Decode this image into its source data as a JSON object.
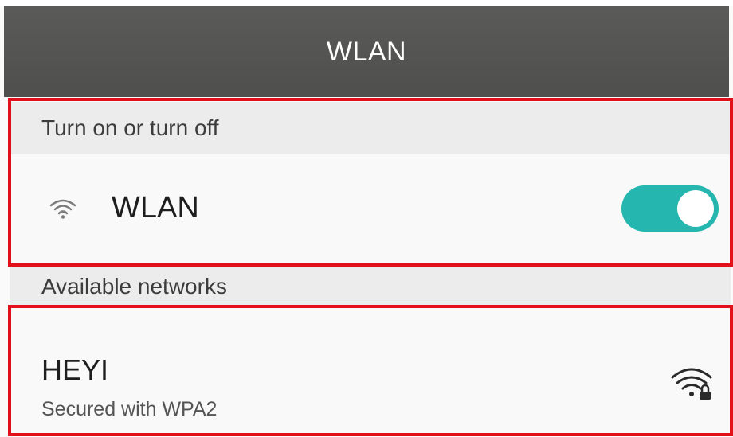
{
  "header": {
    "title": "WLAN"
  },
  "toggle_section": {
    "header": "Turn on or turn off",
    "wlan_label": "WLAN",
    "wlan_enabled": true,
    "icon": "wifi-icon"
  },
  "networks_section": {
    "header": "Available networks",
    "networks": [
      {
        "name": "HEYI",
        "security": "Secured with WPA2",
        "icon": "wifi-lock-icon"
      }
    ]
  },
  "colors": {
    "title_bar": "#555553",
    "toggle_on": "#25b6b0",
    "highlight": "#e2101a"
  }
}
